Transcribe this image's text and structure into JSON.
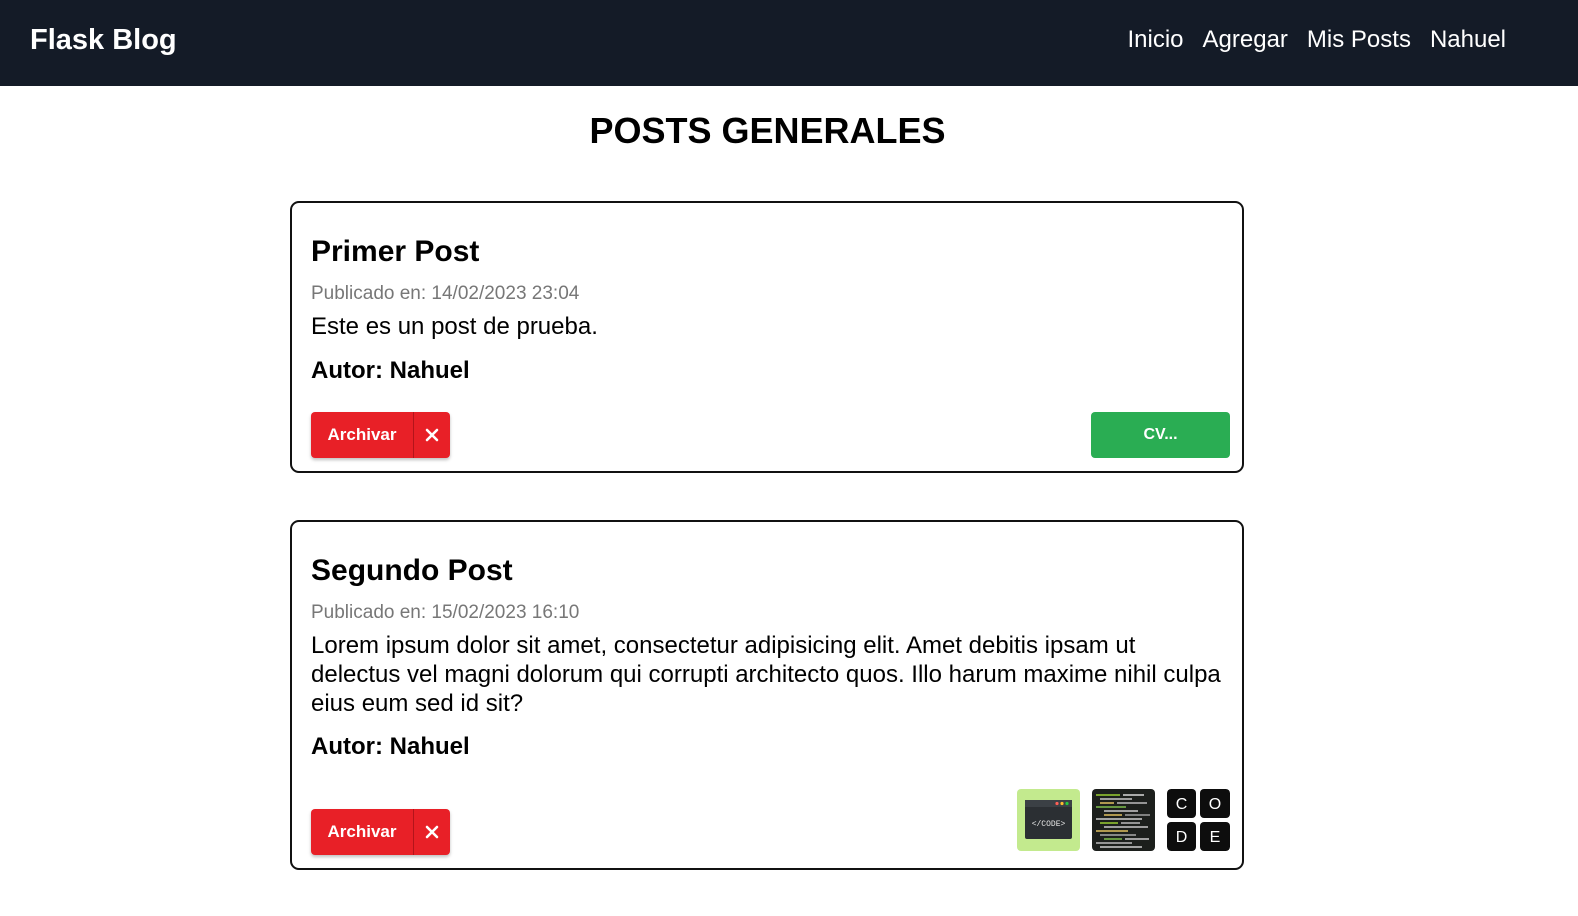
{
  "navbar": {
    "brand": "Flask Blog",
    "links": [
      "Inicio",
      "Agregar",
      "Mis Posts",
      "Nahuel"
    ],
    "background": "#141b27"
  },
  "page": {
    "title": "POSTS GENERALES"
  },
  "posts": [
    {
      "title": "Primer Post",
      "date": "Publicado en: 14/02/2023 23:04",
      "body": "Este es un post de prueba.",
      "author": "Autor: Nahuel",
      "archive_label": "Archivar",
      "attachment_label": "CV..."
    },
    {
      "title": "Segundo Post",
      "date": "Publicado en: 15/02/2023 16:10",
      "body": "Lorem ipsum dolor sit amet, consectetur adipisicing elit. Amet debitis ipsam ut delectus vel magni dolorum qui corrupti architecto quos. Illo harum maxime nihil culpa eius eum sed id sit?",
      "author": "Autor: Nahuel",
      "archive_label": "Archivar",
      "thumbnails": [
        {
          "icon": "code-window-thumbnail",
          "caption": "</CODE>"
        },
        {
          "icon": "code-screen-thumbnail"
        },
        {
          "icon": "code-blocks-thumbnail",
          "letters": [
            "C",
            "O",
            "D",
            "E"
          ]
        }
      ]
    }
  ],
  "colors": {
    "archive": "#e82027",
    "cv": "#2aad53",
    "date_text": "#777777"
  }
}
